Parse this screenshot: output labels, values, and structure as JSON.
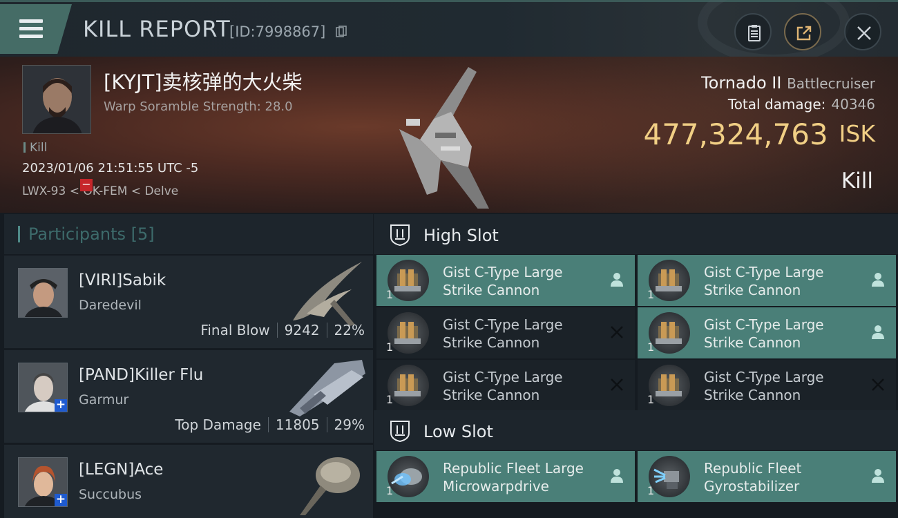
{
  "header": {
    "title": "KILL REPORT",
    "kill_id": "[ID:7998867]"
  },
  "victim": {
    "name": "[KYJT]卖核弹的大火柴",
    "scramble": "Warp Soramble Strength: 28.0",
    "tag": "Kill",
    "datetime": "2023/01/06 21:51:55 UTC -5",
    "location": "LWX-93 < OK-FEM < Delve",
    "ship": "Tornado II",
    "ship_class": "Battlecruiser",
    "total_damage_label": "Total damage:",
    "total_damage": "40346",
    "isk_value": "477,324,763",
    "isk_unit": "ISK",
    "result_label": "Kill"
  },
  "participants": {
    "title": "Participants [5]",
    "items": [
      {
        "name": "[VIRI]Sabik",
        "ship": "Daredevil",
        "role": "Final Blow",
        "damage": "9242",
        "percent": "22%",
        "badge": "none"
      },
      {
        "name": "[PAND]Killer Flu",
        "ship": "Garmur",
        "role": "Top Damage",
        "damage": "11805",
        "percent": "29%",
        "badge": "plus"
      },
      {
        "name": "[LEGN]Ace",
        "ship": "Succubus",
        "badge": "plus"
      }
    ]
  },
  "fitting": {
    "high_slot_label": "High Slot",
    "low_slot_label": "Low Slot",
    "high_slots": [
      {
        "line1": "Gist C-Type Large",
        "line2": "Strike Cannon",
        "qty": "1",
        "status": "active"
      },
      {
        "line1": "Gist C-Type Large",
        "line2": "Strike Cannon",
        "qty": "1",
        "status": "active"
      },
      {
        "line1": "Gist C-Type Large",
        "line2": "Strike Cannon",
        "qty": "1",
        "status": "destroyed"
      },
      {
        "line1": "Gist C-Type Large",
        "line2": "Strike Cannon",
        "qty": "1",
        "status": "active"
      },
      {
        "line1": "Gist C-Type Large",
        "line2": "Strike Cannon",
        "qty": "1",
        "status": "destroyed"
      },
      {
        "line1": "Gist C-Type Large",
        "line2": "Strike Cannon",
        "qty": "1",
        "status": "destroyed"
      }
    ],
    "low_slots": [
      {
        "line1": "Republic Fleet Large",
        "line2": "Microwarpdrive",
        "qty": "1",
        "status": "active"
      },
      {
        "line1": "Republic Fleet",
        "line2": "Gyrostabilizer",
        "qty": "1",
        "status": "active"
      }
    ]
  },
  "colors": {
    "accent_teal": "#4a7f78",
    "isk_gold": "#f1cf85",
    "badge_red": "#c6262a",
    "badge_blue": "#1f5bd0"
  }
}
